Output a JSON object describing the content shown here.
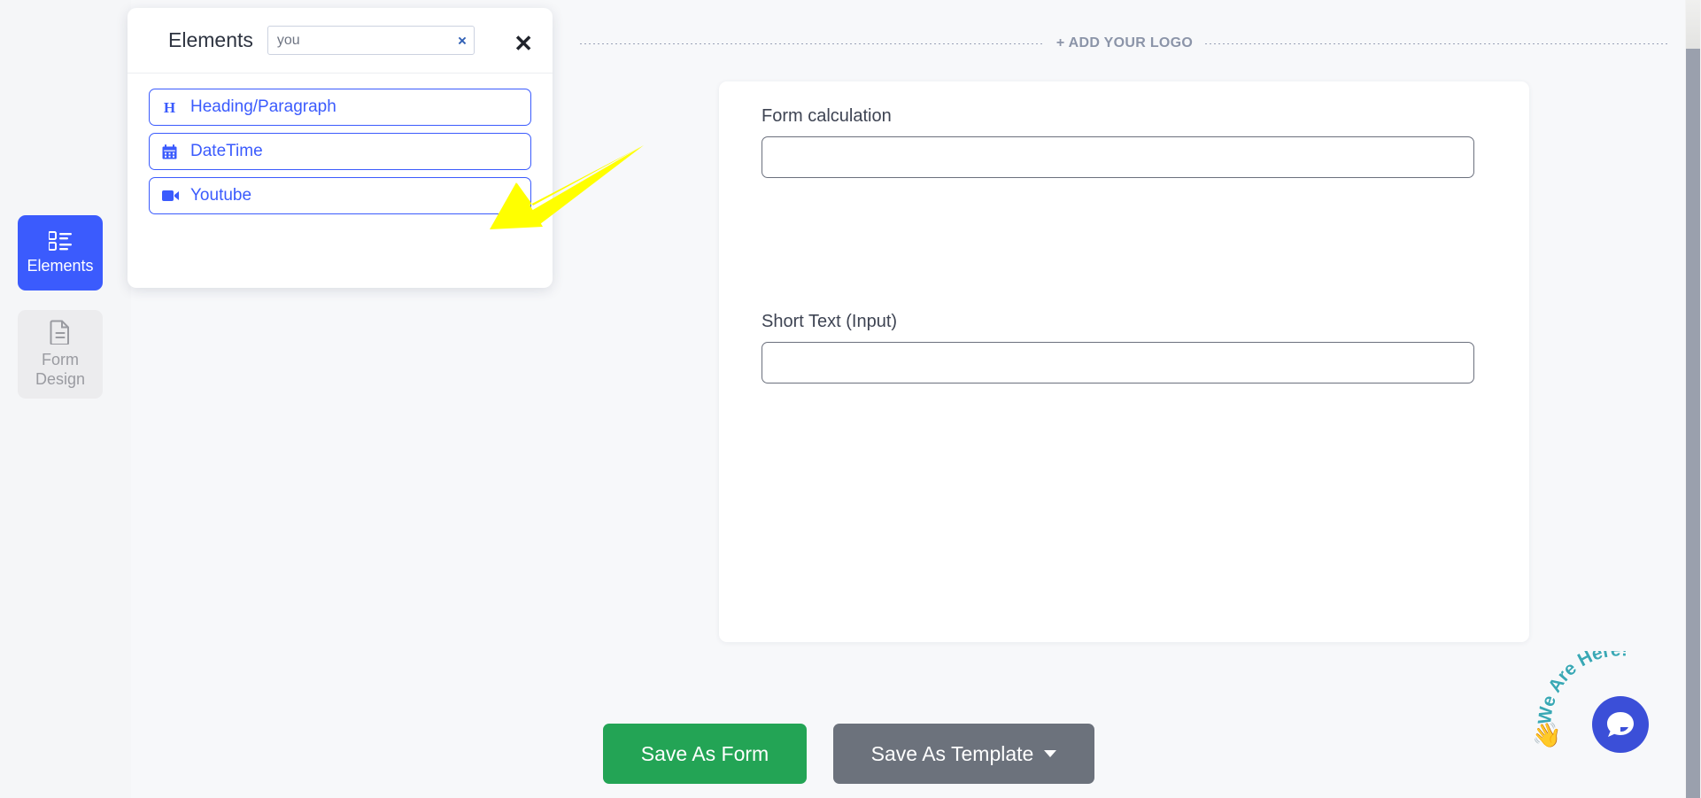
{
  "sidebar": {
    "items": [
      {
        "label": "Elements",
        "icon": "list-blocks-icon",
        "active": true
      },
      {
        "label": "Form Design",
        "label_line1": "Form",
        "label_line2": "Design",
        "icon": "document-icon",
        "active": false
      }
    ]
  },
  "elements_panel": {
    "title": "Elements",
    "search": {
      "value": "you",
      "placeholder": ""
    },
    "clear_label": "×",
    "close_label": "✕",
    "items": [
      {
        "label": "Heading/Paragraph",
        "icon": "heading-icon"
      },
      {
        "label": "DateTime",
        "icon": "calendar-icon"
      },
      {
        "label": "Youtube",
        "icon": "video-camera-icon"
      }
    ]
  },
  "canvas": {
    "logo_placeholder": "+ ADD YOUR LOGO",
    "fields": [
      {
        "label": "Form calculation",
        "value": "",
        "placeholder": ""
      },
      {
        "label": "Short Text (Input)",
        "value": "",
        "placeholder": ""
      }
    ]
  },
  "footer": {
    "save_form_label": "Save As Form",
    "save_template_label": "Save As Template"
  },
  "chat": {
    "badge_text": "We Are Here!",
    "hand_emoji": "👋"
  },
  "colors": {
    "accent_blue": "#3b5bfd",
    "save_green": "#23a455",
    "template_gray": "#6c727c",
    "chat_blue": "#3b4fd8",
    "annotation_yellow": "#ffff00",
    "badge_teal": "#3aa8b5"
  }
}
